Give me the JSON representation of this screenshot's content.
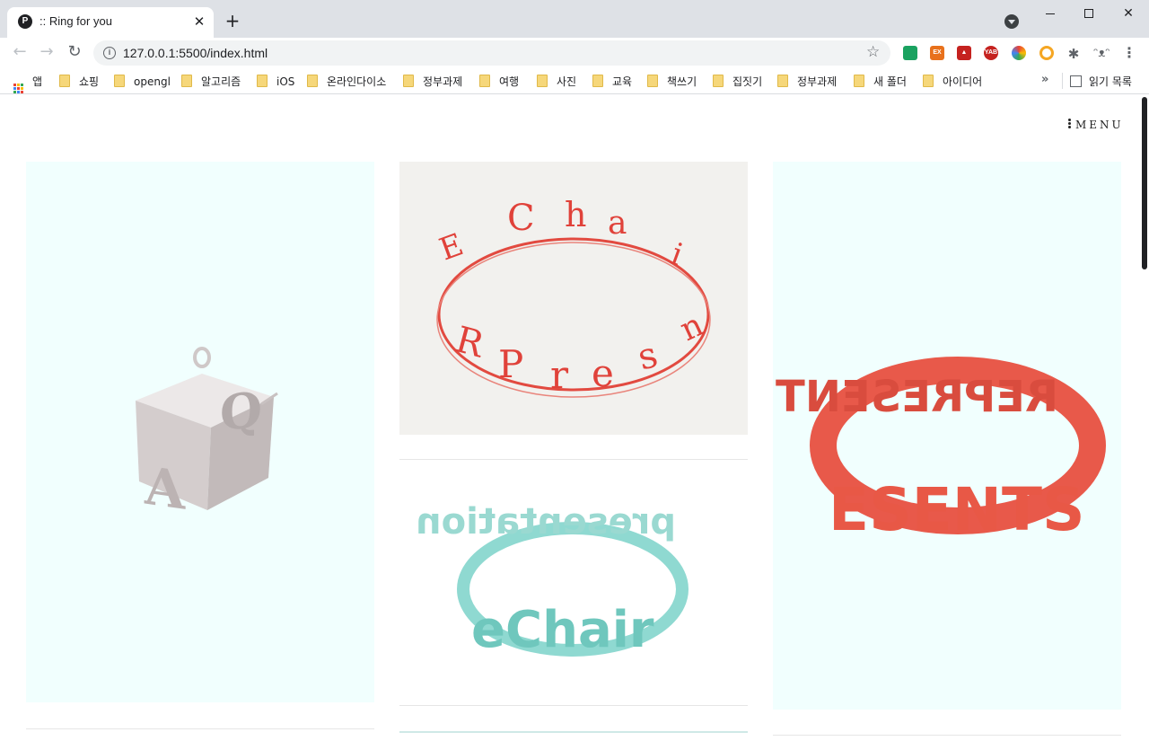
{
  "browser": {
    "tab_title": ":: Ring for you",
    "tab_favicon_letter": "P",
    "url": "127.0.0.1:5500/index.html",
    "bookmarks": [
      {
        "label": "앱",
        "icon": "apps-icon"
      },
      {
        "label": "쇼핑",
        "icon": "folder-icon"
      },
      {
        "label": "opengl",
        "icon": "folder-icon"
      },
      {
        "label": "알고리즘",
        "icon": "folder-icon"
      },
      {
        "label": "iOS",
        "icon": "folder-icon"
      },
      {
        "label": "온라인다이소",
        "icon": "folder-icon"
      },
      {
        "label": "정부과제",
        "icon": "folder-icon"
      },
      {
        "label": "여행",
        "icon": "folder-icon"
      },
      {
        "label": "사진",
        "icon": "folder-icon"
      },
      {
        "label": "교육",
        "icon": "folder-icon"
      },
      {
        "label": "책쓰기",
        "icon": "folder-icon"
      },
      {
        "label": "집짓기",
        "icon": "folder-icon"
      },
      {
        "label": "정부과제",
        "icon": "folder-icon"
      },
      {
        "label": "새 폴더",
        "icon": "folder-icon"
      },
      {
        "label": "아이디어",
        "icon": "folder-icon"
      }
    ],
    "bookmarks_more": "»",
    "reading_list_label": "읽기 목록",
    "extensions": [
      "ext-green-icon",
      "ext-ex-icon",
      "pdf-icon",
      "yab-icon",
      "color-wheel-icon",
      "ring-icon",
      "puzzle-icon",
      "profile-icon"
    ],
    "ext_labels": {
      "ex": "EX",
      "yab": "YAB"
    }
  },
  "page": {
    "menu_label": "MENU",
    "gallery": [
      {
        "name": "letter-cube-pendant",
        "color": "#d9d4d4",
        "letters": "AQ"
      },
      {
        "name": "red-sketch-letter-ring",
        "color": "#e0423a",
        "letters": "CHAIR"
      },
      {
        "name": "teal-letter-ring",
        "color": "#7ccfc7",
        "letters": "presentation Chair"
      },
      {
        "name": "red-3d-letter-ring",
        "color": "#e85846",
        "letters": "REPRESENTS"
      }
    ]
  }
}
